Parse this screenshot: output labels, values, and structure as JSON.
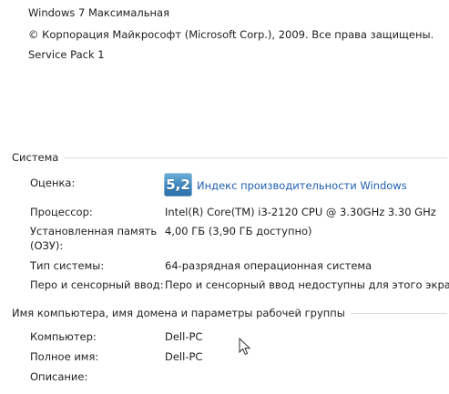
{
  "edition": {
    "name": "Windows 7 Максимальная",
    "copyright": "© Корпорация Майкрософт (Microsoft Corp.), 2009. Все права защищены.",
    "service_pack": "Service Pack 1"
  },
  "system": {
    "heading": "Система",
    "rating": {
      "label": "Оценка:",
      "score": "5,2",
      "link": "Индекс производительности Windows"
    },
    "processor": {
      "label": "Процессор:",
      "value": "Intel(R) Core(TM) i3-2120 CPU @ 3.30GHz   3.30 GHz"
    },
    "memory": {
      "label_line1": "Установленная память",
      "label_line2": "(ОЗУ):",
      "value": "4,00 ГБ (3,90 ГБ доступно)"
    },
    "system_type": {
      "label": "Тип системы:",
      "value": "64-разрядная операционная система"
    },
    "pen_touch": {
      "label": "Перо и сенсорный ввод:",
      "value": "Перо и сенсорный ввод недоступны для этого экрана"
    }
  },
  "computer": {
    "heading": "Имя компьютера, имя домена и параметры рабочей группы",
    "computer_name": {
      "label": "Компьютер:",
      "value": "Dell-PC"
    },
    "full_name": {
      "label": "Полное имя:",
      "value": "Dell-PC"
    },
    "description": {
      "label": "Описание:",
      "value": ""
    }
  },
  "icons": {
    "score_badge": "performance-score-icon",
    "cursor": "mouse-pointer-icon"
  },
  "colors": {
    "link": "#1e5fae",
    "section_rule": "#d9dde3",
    "badge": "#3d86c0"
  }
}
